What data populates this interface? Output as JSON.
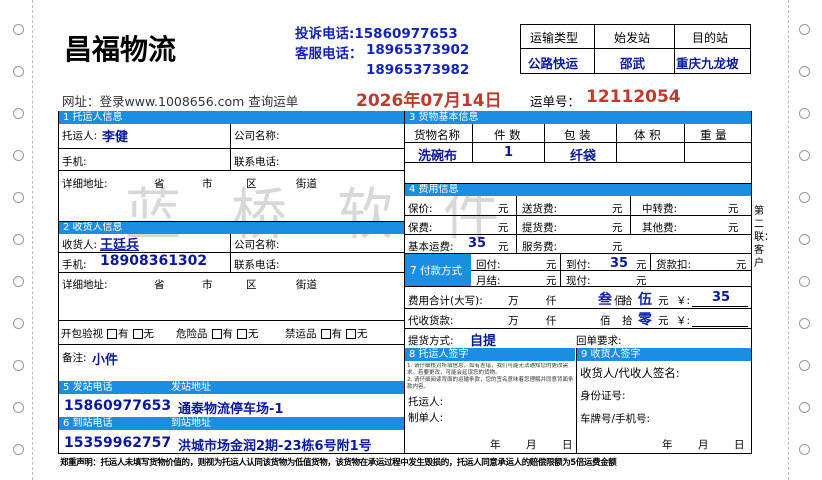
{
  "header": {
    "company": "昌福物流",
    "complaint_phone": "投诉电话:15860977653",
    "service_label": "客服电话：",
    "service_phone_1": "18965373902",
    "service_phone_2": "18965373982",
    "website": "网址：登录www.1008656.com 查询运单",
    "date": "2026年07月14日",
    "waybill_label": "运单号：",
    "waybill_no": "12112054",
    "route_headers": [
      "运输类型",
      "始发站",
      "目的站"
    ],
    "route_values": [
      "公路快运",
      "邵武",
      "重庆九龙坡"
    ]
  },
  "watermark": "蓝桥软件",
  "sections": {
    "s1": "1 托运人信息",
    "s2": "2 收货人信息",
    "s3": "3 货物基本信息",
    "s4": "4 费用信息",
    "s5": "5 发站电话",
    "s5b": "发站地址",
    "s6": "6 到站电话",
    "s6b": "到站地址",
    "s7": "7 付款方式",
    "s8": "8 托运人签字",
    "s9": "9 收货人签字"
  },
  "shipper": {
    "name_label": "托运人:",
    "name": "李健",
    "company_label": "公司名称:",
    "phone_label": "手机:",
    "tel_label": "联系电话:",
    "addr_label": "详细地址:",
    "addr_parts": [
      "省",
      "市",
      "区",
      "街道"
    ]
  },
  "consignee": {
    "name_label": "收货人:",
    "name": "王廷兵",
    "company_label": "公司名称:",
    "phone_label": "手机:",
    "phone": "18908361302",
    "tel_label": "联系电话:",
    "addr_label": "详细地址:",
    "addr_parts": [
      "省",
      "市",
      "区",
      "街道"
    ]
  },
  "goods": {
    "headers": [
      "货物名称",
      "件 数",
      "包 装",
      "体 积",
      "重 量"
    ],
    "values": [
      "洗碗布",
      "1",
      "纤袋",
      "",
      ""
    ]
  },
  "fees": {
    "rows": [
      [
        "保价:",
        "元",
        "送货费:",
        "元",
        "中转费:",
        "元"
      ],
      [
        "保费:",
        "元",
        "提货费:",
        "元",
        "其他费:",
        "元"
      ]
    ],
    "base_label": "基本运费:",
    "base_value": "35",
    "yuan": "元",
    "service_label": "服务费:",
    "pay_now_label": "现付:",
    "pay_back_label": "回付:",
    "pay_arrive_label": "到付:",
    "pay_arrive_value": "35",
    "goods_pay_label": "货款扣:",
    "monthly_label": "月结:",
    "pay_now2_label": "现付:",
    "total_label": "费用合计(大写):",
    "units": [
      "万",
      "仟",
      "佰",
      "拾",
      "元"
    ],
    "total_hundreds": "叁",
    "total_tens": "伍",
    "total_yen_value": "35",
    "cod_label": "代收货款:",
    "cod_tens": "零",
    "yen": "￥:",
    "pickup_label": "提货方式:",
    "pickup_value": "自提",
    "receipt_label": "回单要求:"
  },
  "extras": {
    "check_label": "开包验视",
    "danger_label": "危险品",
    "banned_label": "禁运品",
    "yes": "有",
    "no": "无",
    "remark_label": "备注:",
    "remark": "小件"
  },
  "stations": {
    "origin_phone": "15860977653",
    "origin_addr": "通泰物流停车场-1",
    "dest_phone": "15359962757",
    "dest_addr": "洪城市场金润2期-23栋6号附1号"
  },
  "signatures": {
    "notice": "1. 请仔细核对所填信息，如有差错，我们可能无法通知您的更改需求。若要更改，可能会延误您的货物。\n2. 请仔细阅读背面的运输条款，您的签名意味着您理解并同意背面条款内容。",
    "shipper_label": "托运人:",
    "maker_label": "制单人:",
    "date_parts": [
      "年",
      "月",
      "日"
    ],
    "receiver_label": "收货人/代收人签名:",
    "id_label": "身份证号:",
    "plate_label": "车牌号/手机号:"
  },
  "footer": "郑重声明：托运人未填写货物价值的，则视为托运人认同该货物为低值货物，该货物在承运过程中发生毁损的，托运人同意承运人的赔偿限额为5倍运费金额",
  "side_note": "第二联：客户"
}
